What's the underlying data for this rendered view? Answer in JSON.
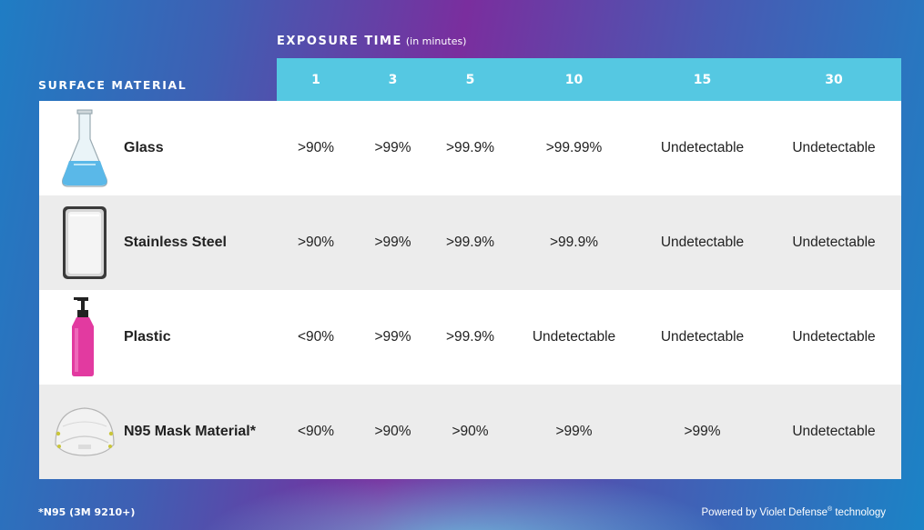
{
  "header": {
    "exposure_title": "EXPOSURE TIME",
    "exposure_unit": "(in minutes)",
    "surface_title": "SURFACE MATERIAL"
  },
  "chart_data": {
    "type": "table",
    "column_header": "EXPOSURE TIME (in minutes)",
    "row_header": "SURFACE MATERIAL",
    "columns": [
      "1",
      "3",
      "5",
      "10",
      "15",
      "30"
    ],
    "rows": [
      {
        "material": "Glass",
        "icon": "flask-icon",
        "values": [
          ">90%",
          ">99%",
          ">99.9%",
          ">99.99%",
          "Undetectable",
          "Undetectable"
        ]
      },
      {
        "material": "Stainless Steel",
        "icon": "steel-tray-icon",
        "values": [
          ">90%",
          ">99%",
          ">99.9%",
          ">99.9%",
          "Undetectable",
          "Undetectable"
        ]
      },
      {
        "material": "Plastic",
        "icon": "pump-bottle-icon",
        "values": [
          "<90%",
          ">99%",
          ">99.9%",
          "Undetectable",
          "Undetectable",
          "Undetectable"
        ]
      },
      {
        "material": "N95 Mask Material*",
        "icon": "n95-mask-icon",
        "values": [
          "<90%",
          ">90%",
          ">90%",
          ">99%",
          ">99%",
          "Undetectable"
        ]
      }
    ],
    "colors": {
      "header_bar": "#55c8e2",
      "row_shade": "#ececec",
      "glass": "#5ab8e8",
      "plastic": "#e23aa0"
    }
  },
  "footer": {
    "footnote": "*N95 (3M 9210+)",
    "powered_by": "Powered by Violet Defense",
    "powered_mark": "®",
    "powered_suffix": " technology"
  }
}
